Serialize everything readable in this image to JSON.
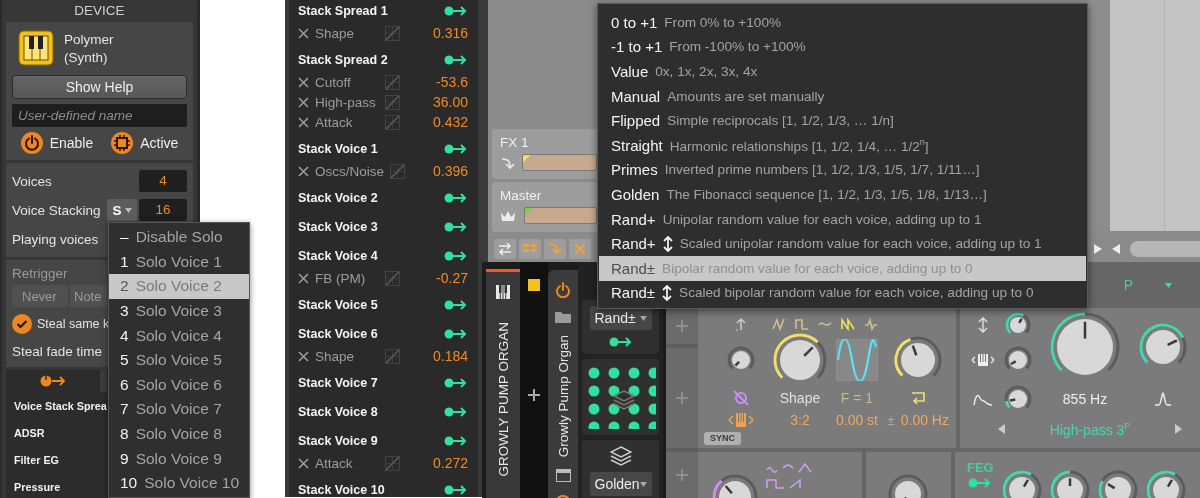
{
  "device_panel": {
    "title": "DEVICE",
    "device_name": "Polymer",
    "device_type": "(Synth)",
    "help_button": "Show Help",
    "name_field": {
      "placeholder": "User-defined name"
    },
    "toggles": [
      {
        "label": "Enable",
        "kind": "power",
        "on": true
      },
      {
        "label": "Active",
        "kind": "chip",
        "on": true
      }
    ],
    "voices": {
      "label": "Voices",
      "value": "4"
    },
    "voice_stacking": {
      "label": "Voice Stacking",
      "mode": "S",
      "value": "16"
    },
    "playing_voices": {
      "label": "Playing voices"
    },
    "retrigger": {
      "label": "Retrigger",
      "options": [
        {
          "label": "Never",
          "selected": false
        },
        {
          "label": "Note",
          "selected": false
        }
      ]
    },
    "steal_same_key": {
      "label": "Steal same k",
      "checked": true
    },
    "steal_fade_time": {
      "label": "Steal fade time"
    },
    "modulators": [
      "Voice Stack Sprea",
      "ADSR",
      "Filter EG",
      "Pressure"
    ]
  },
  "modulation_list": {
    "groups": [
      {
        "title": "Stack Spread 1",
        "targets": [
          {
            "name": "Shape",
            "value": "0.316"
          }
        ]
      },
      {
        "title": "Stack Spread 2",
        "targets": [
          {
            "name": "Cutoff",
            "value": "-53.6"
          },
          {
            "name": "High-pass",
            "value": "36.00"
          },
          {
            "name": "Attack",
            "value": "0.432"
          }
        ]
      },
      {
        "title": "Stack Voice 1",
        "targets": [
          {
            "name": "Oscs/Noise",
            "value": "0.396"
          }
        ]
      },
      {
        "title": "Stack Voice 2"
      },
      {
        "title": "Stack Voice 3"
      },
      {
        "title": "Stack Voice 4",
        "targets": [
          {
            "name": "FB (PM)",
            "value": "-0.27"
          }
        ]
      },
      {
        "title": "Stack Voice 5"
      },
      {
        "title": "Stack Voice 6",
        "targets": [
          {
            "name": "Shape",
            "value": "0.184"
          }
        ]
      },
      {
        "title": "Stack Voice 7"
      },
      {
        "title": "Stack Voice 8"
      },
      {
        "title": "Stack Voice 9",
        "targets": [
          {
            "name": "Attack",
            "value": "0.272"
          }
        ]
      },
      {
        "title": "Stack Voice 10"
      }
    ]
  },
  "arranger": {
    "tracks": [
      {
        "name": "FX 1",
        "kind": "fx"
      },
      {
        "name": "Master",
        "kind": "master"
      }
    ]
  },
  "device_chain": {
    "track_name": "GROWLY PUMP ORGAN",
    "device_name": "Growly Pump Organ",
    "modulators": [
      {
        "kind": "spread",
        "mode": "Rand±"
      },
      {
        "kind": "layers",
        "mode": "Golden"
      }
    ]
  },
  "polymer": {
    "preset_tag": "P",
    "shape_label": "Shape",
    "frequency_label": "F = 1",
    "ratio": "3:2",
    "semitones": "0.00 st",
    "offset_sign": "±",
    "offset": "0.00 Hz",
    "cutoff": "855 Hz",
    "filter_type": "High-pass 3$^{P}$",
    "sync_label": "SYNC",
    "envelope_label": "FEG"
  },
  "solo_menu": {
    "items": [
      {
        "number": "–",
        "label": "Disable Solo",
        "selected": false
      },
      {
        "number": "1",
        "label": "Solo Voice 1",
        "selected": false
      },
      {
        "number": "2",
        "label": "Solo Voice 2",
        "selected": true
      },
      {
        "number": "3",
        "label": "Solo Voice 3",
        "selected": false
      },
      {
        "number": "4",
        "label": "Solo Voice 4",
        "selected": false
      },
      {
        "number": "5",
        "label": "Solo Voice 5",
        "selected": false
      },
      {
        "number": "6",
        "label": "Solo Voice 6",
        "selected": false
      },
      {
        "number": "7",
        "label": "Solo Voice 7",
        "selected": false
      },
      {
        "number": "8",
        "label": "Solo Voice 8",
        "selected": false
      },
      {
        "number": "9",
        "label": "Solo Voice 9",
        "selected": false
      },
      {
        "number": "10",
        "label": "Solo Voice 10",
        "selected": false
      }
    ]
  },
  "spread_menu": {
    "items": [
      {
        "label": "0 to +1",
        "scaled": false,
        "description": "From 0% to +100%",
        "selected": false
      },
      {
        "label": "-1 to +1",
        "scaled": false,
        "description": "From -100% to +100%",
        "selected": false
      },
      {
        "label": "Value",
        "scaled": false,
        "description": "0x, 1x, 2x, 3x, 4x",
        "selected": false
      },
      {
        "label": "Manual",
        "scaled": false,
        "description": "Amounts are set manually",
        "selected": false
      },
      {
        "label": "Flipped",
        "scaled": false,
        "description": "Simple reciprocals [1, 1/2, 1/3, … 1/n]",
        "selected": false
      },
      {
        "label": "Straight",
        "scaled": false,
        "description": "Harmonic relationships [1, 1/2, 1/4, … 1/2$^{n}$]",
        "selected": false
      },
      {
        "label": "Primes",
        "scaled": false,
        "description": "Inverted prime numbers [1, 1/2, 1/3, 1/5, 1/7, 1/11…]",
        "selected": false
      },
      {
        "label": "Golden",
        "scaled": false,
        "description": "The Fibonacci sequence [1, 1/2, 1/3, 1/5, 1/8, 1/13…]",
        "selected": false
      },
      {
        "label": "Rand+",
        "scaled": false,
        "description": "Unipolar random value for each voice, adding up to 1",
        "selected": false
      },
      {
        "label": "Rand+",
        "scaled": true,
        "description": "Scaled unipolar random value for each voice, adding up to 1",
        "selected": false
      },
      {
        "label": "Rand±",
        "scaled": false,
        "description": "Bipolar random value for each voice, adding up to 0",
        "selected": true
      },
      {
        "label": "Rand±",
        "scaled": true,
        "description": "Scaled bipolar random value for each voice, adding up to 0",
        "selected": false
      }
    ]
  }
}
